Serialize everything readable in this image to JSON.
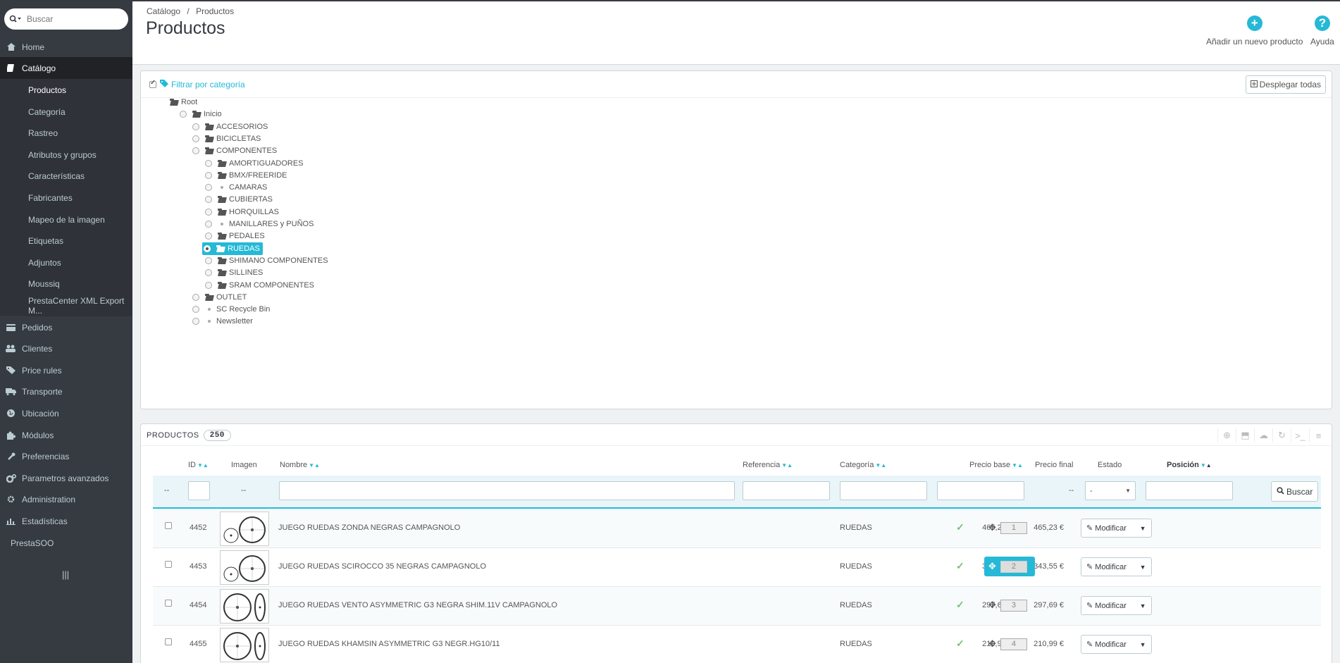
{
  "sidebar": {
    "search_placeholder": "Buscar",
    "items": [
      {
        "label": "Home",
        "icon": "home-icon"
      },
      {
        "label": "Catálogo",
        "icon": "book-icon"
      },
      {
        "label": "Pedidos",
        "icon": "credit-card-icon"
      },
      {
        "label": "Clientes",
        "icon": "users-icon"
      },
      {
        "label": "Price rules",
        "icon": "tags-icon"
      },
      {
        "label": "Transporte",
        "icon": "truck-icon"
      },
      {
        "label": "Ubicación",
        "icon": "globe-icon"
      },
      {
        "label": "Módulos",
        "icon": "puzzle-icon"
      },
      {
        "label": "Preferencias",
        "icon": "wrench-icon"
      },
      {
        "label": "Parametros avanzados",
        "icon": "cogs-icon"
      },
      {
        "label": "Administration",
        "icon": "gear-icon"
      },
      {
        "label": "Estadísticas",
        "icon": "bar-chart-icon"
      },
      {
        "label": "PrestaSOO",
        "icon": ""
      }
    ],
    "catalog_subitems": [
      "Productos",
      "Categoría",
      "Rastreo",
      "Atributos y grupos",
      "Características",
      "Fabricantes",
      "Mapeo de la imagen",
      "Etiquetas",
      "Adjuntos",
      "Moussiq",
      "PrestaCenter XML Export M..."
    ],
    "collapse_icon": "|||"
  },
  "header": {
    "breadcrumb_parent": "Catálogo",
    "breadcrumb_sep": "/",
    "breadcrumb_current": "Productos",
    "title": "Productos",
    "add_label": "Añadir un nuevo producto",
    "help_label": "Ayuda",
    "add_icon": "+",
    "help_icon": "?"
  },
  "category_filter": {
    "label": "Filtrar por categoría",
    "expand_label": "Desplegar todas",
    "tree": [
      {
        "label": "Root",
        "type": "folder",
        "radio": false
      },
      {
        "label": "Inicio",
        "type": "folder",
        "radio": true
      },
      {
        "label": "ACCESORIOS",
        "type": "folder",
        "radio": true
      },
      {
        "label": "BICICLETAS",
        "type": "folder",
        "radio": true
      },
      {
        "label": "COMPONENTES",
        "type": "folder",
        "radio": true
      },
      {
        "label": "AMORTIGUADORES",
        "type": "folder",
        "radio": true
      },
      {
        "label": "BMX/FREERIDE",
        "type": "folder",
        "radio": true
      },
      {
        "label": "CAMARAS",
        "type": "leaf",
        "radio": true
      },
      {
        "label": "CUBIERTAS",
        "type": "folder",
        "radio": true
      },
      {
        "label": "HORQUILLAS",
        "type": "folder",
        "radio": true
      },
      {
        "label": "MANILLARES y PUÑOS",
        "type": "leaf",
        "radio": true
      },
      {
        "label": "PEDALES",
        "type": "folder",
        "radio": true
      },
      {
        "label": "RUEDAS",
        "type": "folder",
        "radio": true,
        "selected": true
      },
      {
        "label": "SHIMANO COMPONENTES",
        "type": "folder",
        "radio": true
      },
      {
        "label": "SILLINES",
        "type": "folder",
        "radio": true
      },
      {
        "label": "SRAM COMPONENTES",
        "type": "folder",
        "radio": true
      },
      {
        "label": "OUTLET",
        "type": "folder",
        "radio": true
      },
      {
        "label": "SC Recycle Bin",
        "type": "leaf",
        "radio": true
      },
      {
        "label": "Newsletter",
        "type": "leaf",
        "radio": true
      }
    ]
  },
  "products": {
    "title": "PRODUCTOS",
    "count": "250",
    "columns": {
      "id": "ID",
      "image": "Imagen",
      "name": "Nombre",
      "reference": "Referencia",
      "category": "Categoría",
      "base_price": "Precio base",
      "final_price": "Precio final",
      "status": "Estado",
      "position": "Posición"
    },
    "filter": {
      "dash": "--",
      "status_value": "-",
      "search_label": "Buscar"
    },
    "rows": [
      {
        "id": "4452",
        "name": "JUEGO RUEDAS ZONDA NEGRAS CAMPAGNOLO",
        "category": "RUEDAS",
        "base_price": "465,23 €",
        "final_price": "465,23 €",
        "position": "1",
        "edit": "Modificar"
      },
      {
        "id": "4453",
        "name": "JUEGO RUEDAS SCIROCCO 35 NEGRAS CAMPAGNOLO",
        "category": "RUEDAS",
        "base_price": "343,55 €",
        "final_price": "343,55 €",
        "position": "2",
        "edit": "Modificar"
      },
      {
        "id": "4454",
        "name": "JUEGO RUEDAS VENTO ASYMMETRIC G3 NEGRA SHIM.11V CAMPAGNOLO",
        "category": "RUEDAS",
        "base_price": "297,69 €",
        "final_price": "297,69 €",
        "position": "3",
        "edit": "Modificar"
      },
      {
        "id": "4455",
        "name": "JUEGO RUEDAS KHAMSIN ASYMMETRIC G3 NEGR.HG10/11",
        "category": "RUEDAS",
        "base_price": "210,99 €",
        "final_price": "210,99 €",
        "position": "4",
        "edit": "Modificar"
      }
    ]
  },
  "colors": {
    "accent": "#25b9d7",
    "sidebar": "#363a41",
    "success": "#72c279"
  }
}
